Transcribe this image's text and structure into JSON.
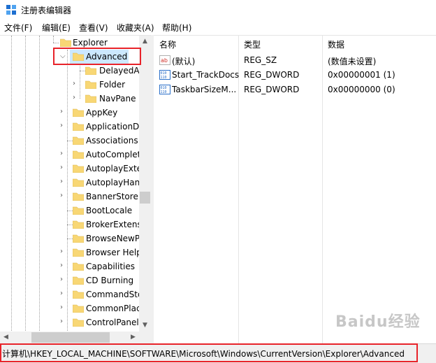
{
  "window": {
    "title": "注册表编辑器",
    "icon": "registry-editor-icon"
  },
  "menu": [
    {
      "label": "文件(F)"
    },
    {
      "label": "编辑(E)"
    },
    {
      "label": "查看(V)"
    },
    {
      "label": "收藏夹(A)"
    },
    {
      "label": "帮助(H)"
    }
  ],
  "tree": {
    "parent": "Explorer",
    "selected": "Advanced",
    "children_of_selected": [
      "DelayedA",
      "Folder",
      "NavPane"
    ],
    "siblings": [
      "AppKey",
      "ApplicationD",
      "Associations",
      "AutoComplet",
      "AutoplayExte",
      "AutoplayHan",
      "BannerStore",
      "BootLocale",
      "BrokerExtens",
      "BrowseNewP",
      "Browser Help",
      "Capabilities",
      "CD Burning",
      "CommandSto",
      "CommonPlac",
      "ControlPanel"
    ]
  },
  "list": {
    "columns": [
      "名称",
      "类型",
      "数据"
    ],
    "rows": [
      {
        "name": "(默认)",
        "type": "REG_SZ",
        "data": "(数值未设置)",
        "icon": "string-value-icon"
      },
      {
        "name": "Start_TrackDocs",
        "type": "REG_DWORD",
        "data": "0x00000001 (1)",
        "icon": "binary-value-icon"
      },
      {
        "name": "TaskbarSizeM...",
        "type": "REG_DWORD",
        "data": "0x00000000 (0)",
        "icon": "binary-value-icon"
      }
    ]
  },
  "status": {
    "path": "计算机\\HKEY_LOCAL_MACHINE\\SOFTWARE\\Microsoft\\Windows\\CurrentVersion\\Explorer\\Advanced"
  },
  "watermark": "Baidu经验",
  "colors": {
    "selection": "#e5f3ff",
    "highlight_box": "#e8232a",
    "folder": "#f8d775"
  }
}
